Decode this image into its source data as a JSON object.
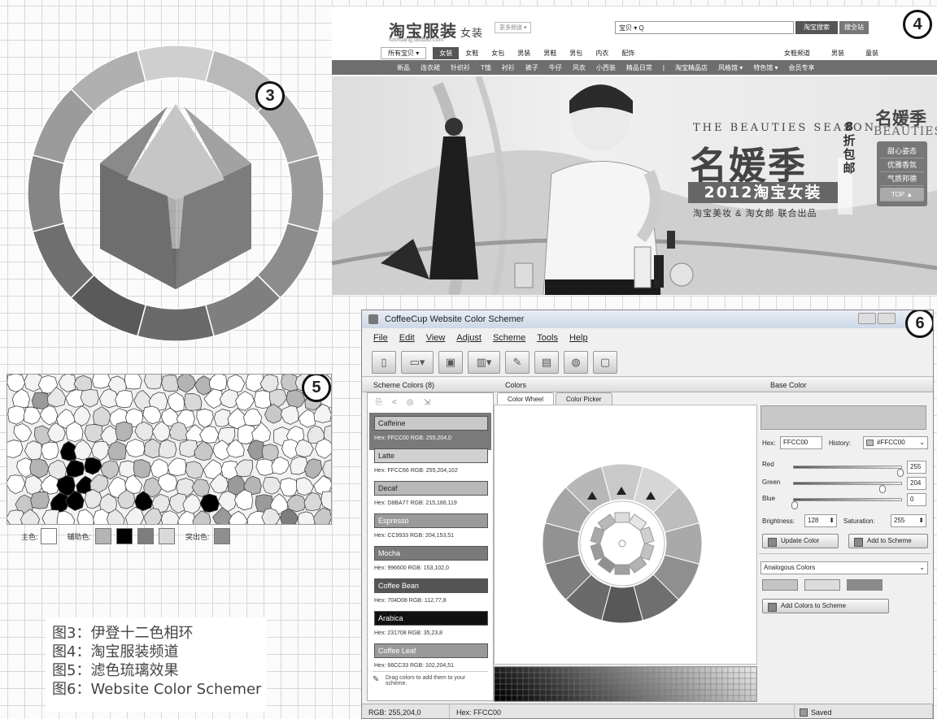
{
  "badges": {
    "fig3": "3",
    "fig4": "4",
    "fig5": "5",
    "fig6": "6"
  },
  "fig3": {
    "outer_ring_colors": [
      "#cfcfcf",
      "#b9b9b9",
      "#a7a7a7",
      "#9a9a9a",
      "#8c8c8c",
      "#7f7f7f",
      "#6a6a6a",
      "#5a5a5a",
      "#6f6f6f",
      "#858585",
      "#9b9b9b",
      "#b0b0b0"
    ],
    "inner_colors": {
      "top": "#c6c6c6",
      "upper_left": "#8a8a8a",
      "upper_right": "#a2a2a2",
      "lower_left": "#6e6e6e",
      "lower_right": "#7c7c7c",
      "bottom": "#4f4f4f"
    }
  },
  "fig4": {
    "logo": "淘宝服装",
    "logo_sub": "女装",
    "domain": "fushuang.taobao.com",
    "tag": "更多频道 ▾",
    "search_placeholder": "宝贝 ▾  Q",
    "search_button": "淘宝搜索",
    "search_button2": "搜全站",
    "nav_category": "所有宝贝 ▾",
    "nav_main": [
      "女装",
      "女鞋",
      "女包",
      "男装",
      "男鞋",
      "男包",
      "内衣",
      "配饰"
    ],
    "nav_right": [
      "女鞋频道",
      "男装",
      "童装"
    ],
    "nav_sub": [
      "新品",
      "连衣裙",
      "针织衫",
      "T恤",
      "衬衫",
      "裤子",
      "牛仔",
      "风衣",
      "小西装",
      "精品日常",
      "|",
      "淘宝精品店",
      "风格馆 ▾",
      "特色馆 ▾",
      "会员专享"
    ],
    "banner_season": "THE BEAUTIES SEASON",
    "banner_big": "名媛季",
    "banner_discount": "8折包邮",
    "banner_year": "2012淘宝女装",
    "banner_org": "淘宝美妆 & 淘女郎 联合出品",
    "side_title": "名媛季",
    "side_sub": "BEAUTIES",
    "side_items": [
      "甜心姿态",
      "优雅香氛",
      "气质邦德"
    ],
    "side_top": "TOP ▲"
  },
  "fig5": {
    "legend_main_label": "主色:",
    "legend_aux_label": "辅助色:",
    "legend_accent_label": "突出色:",
    "main_color": "#ffffff",
    "aux_colors": [
      "#b4b4b4",
      "#000000",
      "#7d7d7d",
      "#d9d9d9"
    ],
    "accent_color": "#8f8f8f"
  },
  "captions": [
    "图3：伊登十二色相环",
    "图4：淘宝服装频道",
    "图5：滤色琉璃效果",
    "图6：Website Color Schemer"
  ],
  "fig6": {
    "title": "CoffeeCup Website Color Schemer",
    "menu": [
      "File",
      "Edit",
      "View",
      "Adjust",
      "Scheme",
      "Tools",
      "Help"
    ],
    "panel_left_title": "Scheme Colors (8)",
    "panel_mid_title": "Colors",
    "panel_right_title": "Base Color",
    "tabs": [
      "Color Wheel",
      "Color Picker"
    ],
    "schemes": [
      {
        "name": "Caffeine",
        "hex": "Hex: FFCC00  RGB: 255,204,0",
        "color": "#c8c8c8"
      },
      {
        "name": "Latte",
        "hex": "Hex: FFCC66  RGB: 255,204,102",
        "color": "#d0d0d0"
      },
      {
        "name": "Decaf",
        "hex": "Hex: D8BA77  RGB: 215,186,119",
        "color": "#b8b8b8"
      },
      {
        "name": "Espresso",
        "hex": "Hex: CC9933  RGB: 204,153,51",
        "color": "#9a9a9a"
      },
      {
        "name": "Mocha",
        "hex": "Hex: 996600  RGB: 153,102,0",
        "color": "#7a7a7a"
      },
      {
        "name": "Coffee Bean",
        "hex": "Hex: 704D08  RGB: 112,77,8",
        "color": "#555555"
      },
      {
        "name": "Arabica",
        "hex": "Hex: 231708  RGB: 35,23,8",
        "color": "#111111"
      },
      {
        "name": "Coffee Leaf",
        "hex": "Hex: 66CC33  RGB: 102,204,51",
        "color": "#999999"
      }
    ],
    "drag_hint": "Drag colors to add them to your scheme.",
    "hex_label": "Hex:",
    "hex_value": "FFCC00",
    "history_label": "History:",
    "history_value": "#FFCC00",
    "red_label": "Red",
    "red_value": "255",
    "green_label": "Green",
    "green_value": "204",
    "blue_label": "Blue",
    "blue_value": "0",
    "brightness_label": "Brightness:",
    "brightness_value": "128",
    "saturation_label": "Saturation:",
    "saturation_value": "255",
    "update_btn": "Update Color",
    "add_btn": "Add to Scheme",
    "harmony_value": "Analogous Colors",
    "harmony_colors": [
      "#c4c4c4",
      "#dcdcdc",
      "#8a8a8a"
    ],
    "add_colors_btn": "Add Colors to Scheme",
    "status_rgb": "RGB: 255,204,0",
    "status_hex": "Hex: FFCC00",
    "status_saved": "Saved"
  }
}
